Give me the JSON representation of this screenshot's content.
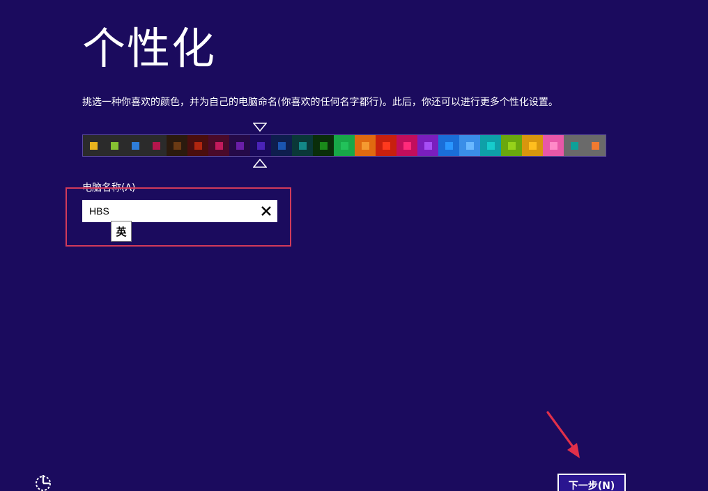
{
  "header": {
    "title": "个性化"
  },
  "instructions": {
    "text": "挑选一种你喜欢的颜色，并为自己的电脑命名(你喜欢的任何名字都行)。此后，你还可以进行更多个性化设置。"
  },
  "color_palette": {
    "selected_index": 8,
    "swatches": [
      {
        "bg": "#2b2b2b",
        "dot": "#e8b31e"
      },
      {
        "bg": "#2b2b2b",
        "dot": "#86c232"
      },
      {
        "bg": "#2b2b2b",
        "dot": "#2e7dd8"
      },
      {
        "bg": "#2b2b2b",
        "dot": "#b4154c"
      },
      {
        "bg": "#2b1a0e",
        "dot": "#6b3a14"
      },
      {
        "bg": "#4a0e0e",
        "dot": "#b0260f"
      },
      {
        "bg": "#4a0a2a",
        "dot": "#c21a5c"
      },
      {
        "bg": "#250a48",
        "dot": "#6a1ea8"
      },
      {
        "bg": "#1a0a5c",
        "dot": "#4a23b8"
      },
      {
        "bg": "#0e1e4e",
        "dot": "#1a55b0"
      },
      {
        "bg": "#0a3838",
        "dot": "#138888"
      },
      {
        "bg": "#0a2e0a",
        "dot": "#1a8a1a"
      },
      {
        "bg": "#18a848",
        "dot": "#22c25a"
      },
      {
        "bg": "#e06a10",
        "dot": "#f59a30"
      },
      {
        "bg": "#c8200e",
        "dot": "#ff3a1e"
      },
      {
        "bg": "#c20e5c",
        "dot": "#ff2a7a"
      },
      {
        "bg": "#7a1ebe",
        "dot": "#a64ef5"
      },
      {
        "bg": "#1a6ed8",
        "dot": "#2a96ff"
      },
      {
        "bg": "#3a8ee8",
        "dot": "#6ab8ff"
      },
      {
        "bg": "#0ea0a8",
        "dot": "#16cccc"
      },
      {
        "bg": "#6aa80e",
        "dot": "#96d21a"
      },
      {
        "bg": "#d8960e",
        "dot": "#ffbe1e"
      },
      {
        "bg": "#e858a8",
        "dot": "#ff8ac8"
      },
      {
        "bg": "#6a6a6a",
        "dot": "#0ea098"
      },
      {
        "bg": "#6a6a6a",
        "dot": "#f07a30"
      }
    ]
  },
  "pc_name": {
    "label": "电脑名称(A)",
    "value": "HBS",
    "ime_mode": "英"
  },
  "footer": {
    "next_label": "下一步(N)"
  },
  "annotations": {
    "highlight_color": "#d23a5a",
    "arrow_color": "#e0304a"
  },
  "icons": {
    "ease_of_access": "ease-of-access-icon",
    "clear": "close-icon",
    "selector_top": "triangle-down-icon",
    "selector_bottom": "triangle-up-icon"
  }
}
